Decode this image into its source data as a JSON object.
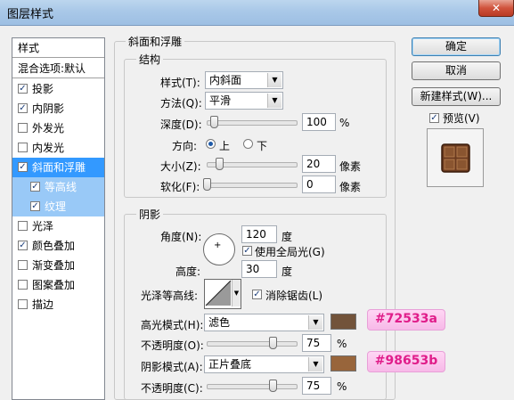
{
  "window": {
    "title": "图层样式",
    "close_glyph": "✕"
  },
  "sidebar": {
    "header": "样式",
    "blend_options": "混合选项:默认",
    "items": [
      {
        "label": "投影",
        "checked": true
      },
      {
        "label": "内阴影",
        "checked": true
      },
      {
        "label": "外发光",
        "checked": false
      },
      {
        "label": "内发光",
        "checked": false
      },
      {
        "label": "斜面和浮雕",
        "checked": true
      },
      {
        "label": "等高线",
        "checked": true
      },
      {
        "label": "纹理",
        "checked": true
      },
      {
        "label": "光泽",
        "checked": false
      },
      {
        "label": "颜色叠加",
        "checked": true
      },
      {
        "label": "渐变叠加",
        "checked": false
      },
      {
        "label": "图案叠加",
        "checked": false
      },
      {
        "label": "描边",
        "checked": false
      }
    ]
  },
  "bevel": {
    "section_title": "斜面和浮雕",
    "structure": {
      "title": "结构",
      "style_label": "样式(T):",
      "style_value": "内斜面",
      "technique_label": "方法(Q):",
      "technique_value": "平滑",
      "depth_label": "深度(D):",
      "depth_value": "100",
      "depth_unit": "%",
      "direction_label": "方向:",
      "dir_up": "上",
      "dir_down": "下",
      "size_label": "大小(Z):",
      "size_value": "20",
      "size_unit": "像素",
      "soften_label": "软化(F):",
      "soften_value": "0",
      "soften_unit": "像素"
    },
    "shading": {
      "title": "阴影",
      "angle_label": "角度(N):",
      "angle_value": "120",
      "angle_unit": "度",
      "global_light_label": "使用全局光(G)",
      "altitude_label": "高度:",
      "altitude_value": "30",
      "altitude_unit": "度",
      "gloss_contour_label": "光泽等高线:",
      "anti_alias_label": "消除锯齿(L)",
      "highlight_mode_label": "高光模式(H):",
      "highlight_mode_value": "滤色",
      "highlight_color": "#72533a",
      "highlight_opacity_label": "不透明度(O):",
      "highlight_opacity_value": "75",
      "highlight_opacity_unit": "%",
      "shadow_mode_label": "阴影模式(A):",
      "shadow_mode_value": "正片叠底",
      "shadow_color": "#98653b",
      "shadow_opacity_label": "不透明度(C):",
      "shadow_opacity_value": "75",
      "shadow_opacity_unit": "%"
    }
  },
  "annotations": {
    "highlight_hex": "#72533a",
    "shadow_hex": "#98653b"
  },
  "buttons": {
    "ok": "确定",
    "cancel": "取消",
    "new_style": "新建样式(W)...",
    "preview": "预览(V)"
  }
}
